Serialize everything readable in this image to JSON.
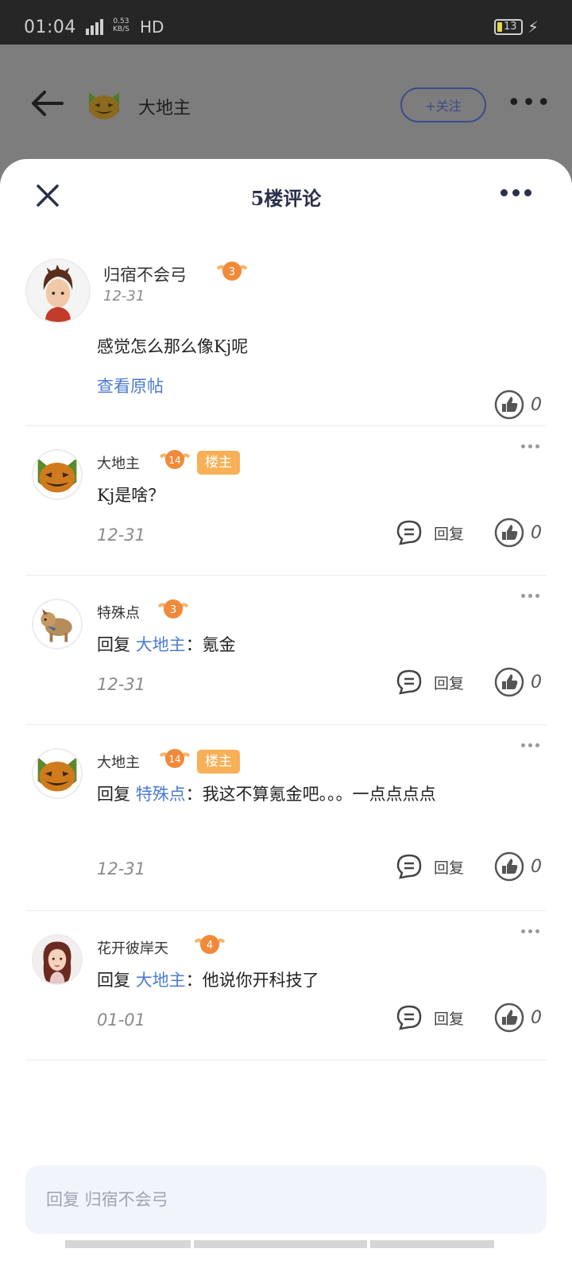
{
  "status_bar": {
    "time": "01:04",
    "net_speed_top": "0.53",
    "net_speed_bottom": "KB/S",
    "hd": "HD",
    "battery": "13"
  },
  "header": {
    "title": "大地主",
    "follow_label": "+关注",
    "more": "•••"
  },
  "sheet": {
    "title": "5楼评论"
  },
  "main_comment": {
    "username": "归宿不会弓",
    "level": "3",
    "date": "12-31",
    "text": "感觉怎么那么像Kj呢",
    "view_post": "查看原帖",
    "likes": "0"
  },
  "replies": [
    {
      "username": "大地主",
      "level": "14",
      "host_badge": "楼主",
      "reply_prefix": "",
      "reply_to": "",
      "text": "Kj是啥？",
      "date": "12-31",
      "reply_label": "回复",
      "likes": "0"
    },
    {
      "username": "特殊点",
      "level": "3",
      "host_badge": "",
      "reply_prefix": "回复 ",
      "reply_to": "大地主",
      "text": "：氪金",
      "date": "12-31",
      "reply_label": "回复",
      "likes": "0"
    },
    {
      "username": "大地主",
      "level": "14",
      "host_badge": "楼主",
      "reply_prefix": "回复 ",
      "reply_to": "特殊点",
      "text": "：我这不算氪金吧。。。一点点点点",
      "date": "12-31",
      "reply_label": "回复",
      "likes": "0"
    },
    {
      "username": "花开彼岸天",
      "level": "4",
      "host_badge": "",
      "reply_prefix": "回复 ",
      "reply_to": "大地主",
      "text": "：他说你开科技了",
      "date": "01-01",
      "reply_label": "回复",
      "likes": "0"
    }
  ],
  "input": {
    "placeholder": "回复 归宿不会弓"
  },
  "colors": {
    "accent": "#4d7bd1",
    "host_badge": "#f7b057",
    "level_badge": "#f08a3a",
    "title": "#2a2f4a"
  }
}
